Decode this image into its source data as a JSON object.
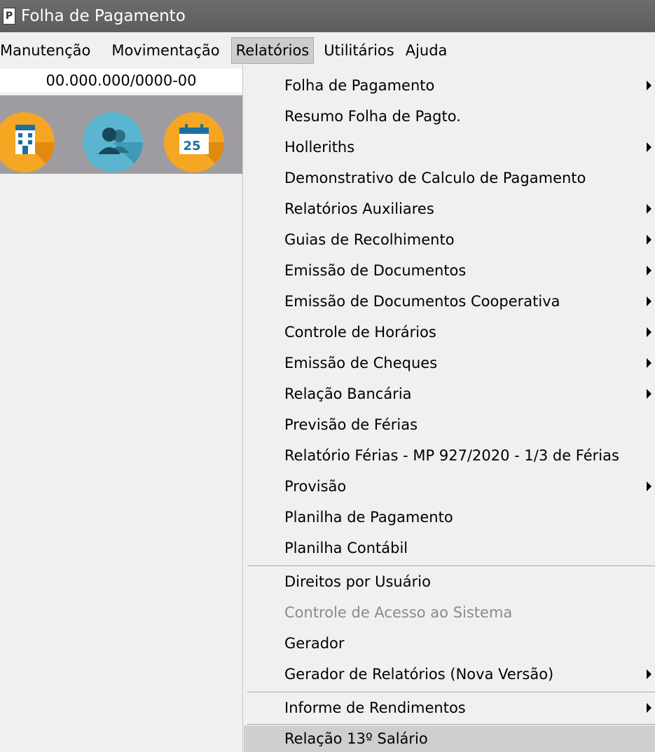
{
  "window": {
    "title": "Folha de Pagamento"
  },
  "menubar": [
    {
      "label": "Manutenção",
      "active": false
    },
    {
      "label": "Movimentação",
      "active": false
    },
    {
      "label": "Relatórios",
      "active": true
    },
    {
      "label": "Utilitários",
      "active": false
    },
    {
      "label": "Ajuda",
      "active": false
    }
  ],
  "company": {
    "cnpj": "00.000.000/0000-00"
  },
  "toolbar": {
    "buttons": [
      {
        "icon": "building-icon",
        "color": "#f5a623"
      },
      {
        "icon": "users-icon",
        "color": "#5bb5cf"
      },
      {
        "icon": "calendar-icon",
        "color": "#f5a623",
        "day": "25"
      }
    ]
  },
  "relatorios_menu": {
    "items": [
      {
        "label": "Folha de Pagamento",
        "submenu": true
      },
      {
        "label": "Resumo Folha de Pagto.",
        "submenu": false
      },
      {
        "label": "Holleriths",
        "submenu": true
      },
      {
        "label": "Demonstrativo de Calculo de Pagamento",
        "submenu": false
      },
      {
        "label": "Relatórios Auxiliares",
        "submenu": true
      },
      {
        "label": "Guias de Recolhimento",
        "submenu": true
      },
      {
        "label": "Emissão de Documentos",
        "submenu": true
      },
      {
        "label": "Emissão de Documentos Cooperativa",
        "submenu": true
      },
      {
        "label": "Controle de Horários",
        "submenu": true
      },
      {
        "label": "Emissão de Cheques",
        "submenu": true
      },
      {
        "label": "Relação Bancária",
        "submenu": true
      },
      {
        "label": "Previsão de Férias",
        "submenu": false
      },
      {
        "label": "Relatório Férias - MP 927/2020 - 1/3 de Férias",
        "submenu": false
      },
      {
        "label": "Provisão",
        "submenu": true
      },
      {
        "label": "Planilha de Pagamento",
        "submenu": false
      },
      {
        "label": "Planilha Contábil",
        "submenu": false
      },
      {
        "label": "Direitos por Usuário",
        "submenu": false
      },
      {
        "label": "Controle de Acesso ao Sistema",
        "submenu": false,
        "disabled": true
      },
      {
        "label": "Gerador",
        "submenu": false
      },
      {
        "label": "Gerador de Relatórios (Nova Versão)",
        "submenu": true
      },
      {
        "label": "Informe de Rendimentos",
        "submenu": true
      },
      {
        "label": "Relação 13º Salário",
        "submenu": false,
        "highlighted": true
      }
    ]
  }
}
